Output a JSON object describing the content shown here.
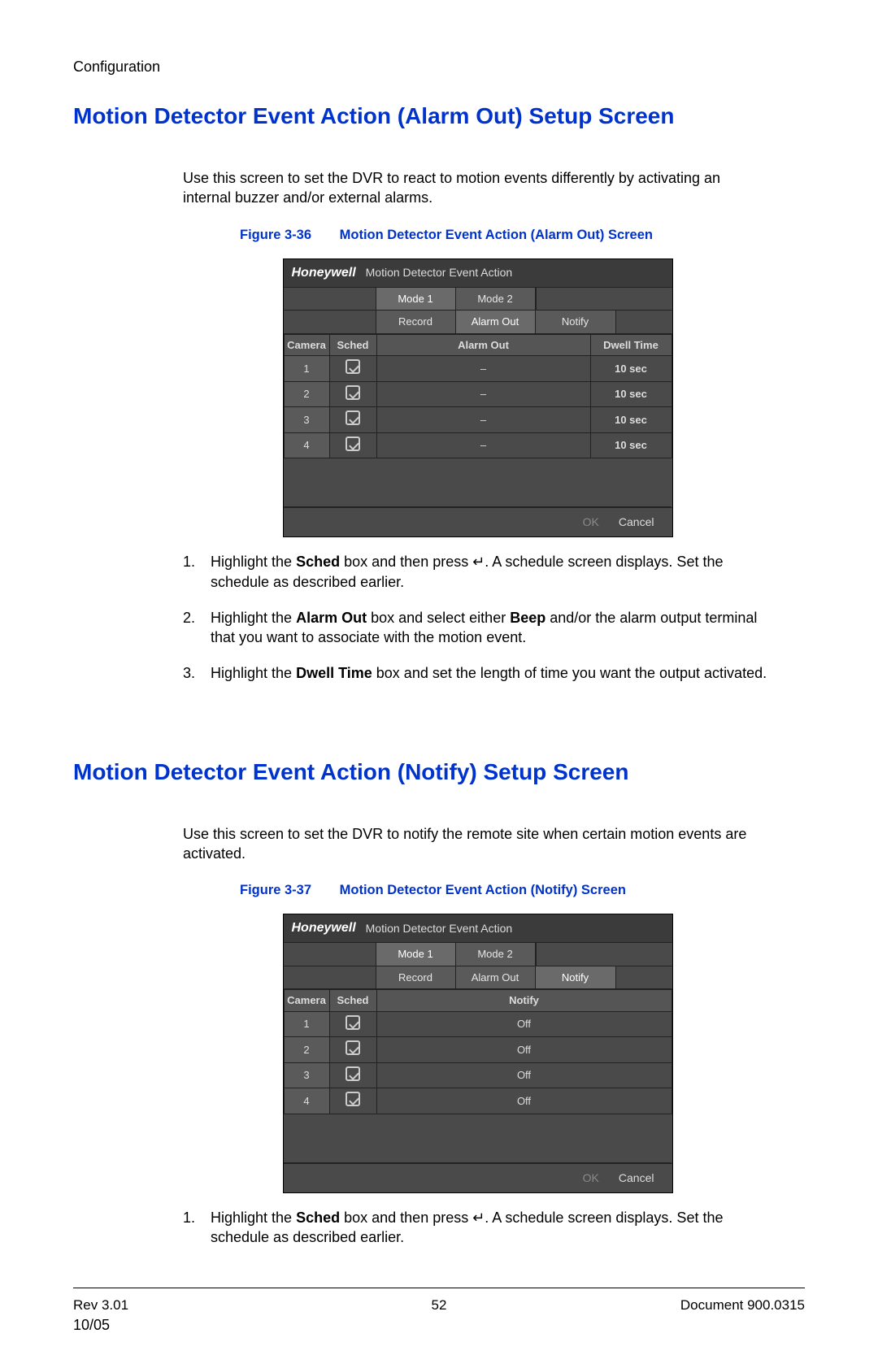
{
  "breadcrumb": "Configuration",
  "section1": {
    "title": "Motion Detector Event Action (Alarm Out) Setup Screen",
    "intro": "Use this screen to set the DVR to react to motion events differently by activating an internal buzzer and/or external alarms.",
    "figure_label": "Figure 3-36",
    "figure_title": "Motion Detector Event Action (Alarm Out) Screen",
    "dvr": {
      "brand": "Honeywell",
      "title": "Motion Detector Event Action",
      "modes": [
        "Mode 1",
        "Mode 2"
      ],
      "subtabs": [
        "Record",
        "Alarm Out",
        "Notify"
      ],
      "active_subtab": "Alarm Out",
      "headers": {
        "camera": "Camera",
        "sched": "Sched",
        "middle": "Alarm Out",
        "right": "Dwell Time"
      },
      "rows": [
        {
          "cam": "1",
          "value": "–",
          "dwell": "10 sec"
        },
        {
          "cam": "2",
          "value": "–",
          "dwell": "10 sec"
        },
        {
          "cam": "3",
          "value": "–",
          "dwell": "10 sec"
        },
        {
          "cam": "4",
          "value": "–",
          "dwell": "10 sec"
        }
      ],
      "ok": "OK",
      "cancel": "Cancel"
    },
    "steps": [
      {
        "n": "1.",
        "pre": "Highlight the ",
        "bold": "Sched",
        "post": " box and then press ↵. A schedule screen displays. Set the schedule as described earlier."
      },
      {
        "n": "2.",
        "pre": "Highlight the ",
        "bold": "Alarm Out",
        "post": " box and select either ",
        "bold2": "Beep",
        "post2": " and/or the alarm output terminal that you want to associate with the motion event."
      },
      {
        "n": "3.",
        "pre": "Highlight the ",
        "bold": "Dwell Time",
        "post": " box and set the length of time you want the output activated."
      }
    ]
  },
  "section2": {
    "title": "Motion Detector Event Action (Notify) Setup Screen",
    "intro": "Use this screen to set the DVR to notify the remote site when certain motion events are activated.",
    "figure_label": "Figure 3-37",
    "figure_title": "Motion Detector Event Action (Notify) Screen",
    "dvr": {
      "brand": "Honeywell",
      "title": "Motion Detector Event Action",
      "modes": [
        "Mode 1",
        "Mode 2"
      ],
      "subtabs": [
        "Record",
        "Alarm Out",
        "Notify"
      ],
      "active_subtab": "Notify",
      "headers": {
        "camera": "Camera",
        "sched": "Sched",
        "middle": "Notify"
      },
      "rows": [
        {
          "cam": "1",
          "value": "Off"
        },
        {
          "cam": "2",
          "value": "Off"
        },
        {
          "cam": "3",
          "value": "Off"
        },
        {
          "cam": "4",
          "value": "Off"
        }
      ],
      "ok": "OK",
      "cancel": "Cancel"
    },
    "steps": [
      {
        "n": "1.",
        "pre": "Highlight the ",
        "bold": "Sched",
        "post": " box and then press ↵. A schedule screen displays. Set the schedule as described earlier."
      }
    ]
  },
  "footer": {
    "rev": "Rev 3.01",
    "page": "52",
    "doc": "Document 900.0315",
    "date": "10/05"
  }
}
